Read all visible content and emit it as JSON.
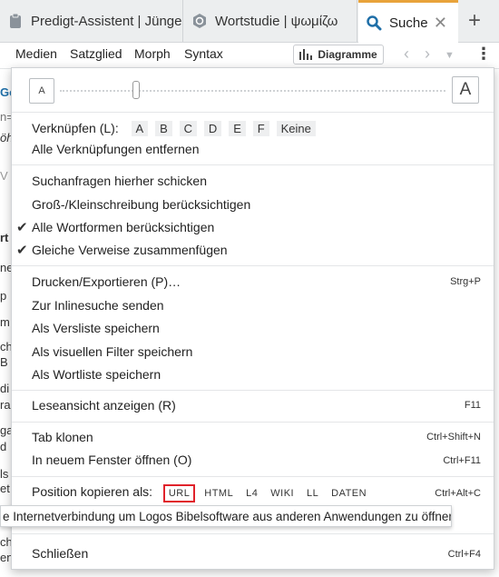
{
  "tabs": [
    {
      "label": "Predigt-Assistent | Jüngerschaft",
      "icon": "clipboard-icon"
    },
    {
      "label": "Wortstudie | ψωμίζω",
      "icon": "word-study-icon"
    },
    {
      "label": "Suche",
      "icon": "search-icon",
      "active": true
    }
  ],
  "toolbar": {
    "menu": [
      "Medien",
      "Satzglied",
      "Morph",
      "Syntax"
    ],
    "diagram_label": "Diagramme"
  },
  "background_fragments": [
    "Go",
    "n=",
    "öh",
    "V",
    "rt",
    "ne",
    "p",
    "m",
    "ch",
    "B",
    "di",
    "ra",
    "ga",
    "d",
    "ls",
    "et",
    "ch",
    "en"
  ],
  "menu": {
    "font_small": "A",
    "font_large": "A",
    "link_label": "Verknüpfen (L):",
    "link_options": [
      "A",
      "B",
      "C",
      "D",
      "E",
      "F",
      "Keine"
    ],
    "remove_links": "Alle Verknüpfungen entfernen",
    "send_here": "Suchanfragen hierher schicken",
    "case_sensitive": "Groß-/Kleinschreibung berücksichtigen",
    "all_wordforms": "Alle Wortformen berücksichtigen",
    "merge_refs": "Gleiche Verweise zusammenfügen",
    "print_export": "Drucken/Exportieren (P)…",
    "print_shortcut": "Strg+P",
    "inline_search": "Zur Inlinesuche senden",
    "save_verselist": "Als Versliste speichern",
    "save_visual_filter": "Als visuellen Filter speichern",
    "save_wordlist": "Als Wortliste speichern",
    "reading_view": "Leseansicht anzeigen (R)",
    "reading_shortcut": "F11",
    "clone_tab": "Tab klonen",
    "clone_shortcut": "Ctrl+Shift+N",
    "new_window": "In neuem Fenster öffnen (O)",
    "new_window_shortcut": "Ctrl+F11",
    "copy_position_label": "Position kopieren als:",
    "copy_formats": [
      "URL",
      "HTML",
      "L4",
      "WIKI",
      "LL",
      "DATEN"
    ],
    "copy_shortcut": "Ctrl+Alt+C",
    "tooltip": "e Internetverbindung um Logos Bibelsoftware aus anderen Anwendungen zu öffnen.",
    "close": "Schließen",
    "close_shortcut": "Ctrl+F4"
  }
}
